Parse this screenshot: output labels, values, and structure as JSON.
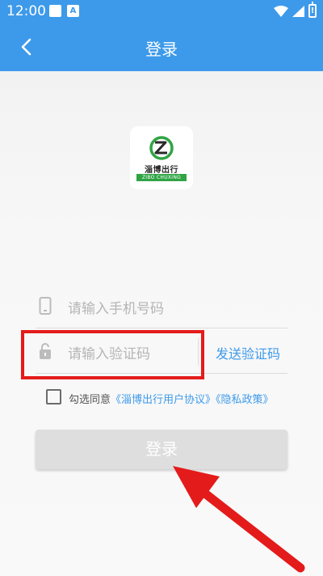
{
  "status_bar": {
    "time": "12:00"
  },
  "header": {
    "title": "登录",
    "back_icon": "chevron-left-icon"
  },
  "logo": {
    "name_cn": "淄博出行",
    "name_en": "ZIBO CHUXING",
    "mark_color": "#2fa444"
  },
  "phone_field": {
    "placeholder": "请输入手机号码",
    "icon": "phone-icon"
  },
  "code_field": {
    "placeholder": "请输入验证码",
    "icon": "lock-icon",
    "send_label": "发送验证码"
  },
  "agreement": {
    "prefix": "勾选同意",
    "user_agreement": "《淄博出行用户协议》",
    "privacy_policy": "《隐私政策》",
    "checked": false
  },
  "login_button": {
    "label": "登录"
  },
  "colors": {
    "accent": "#3d9aea",
    "annotation": "#e41b1b",
    "disabled_button": "#dedede"
  }
}
